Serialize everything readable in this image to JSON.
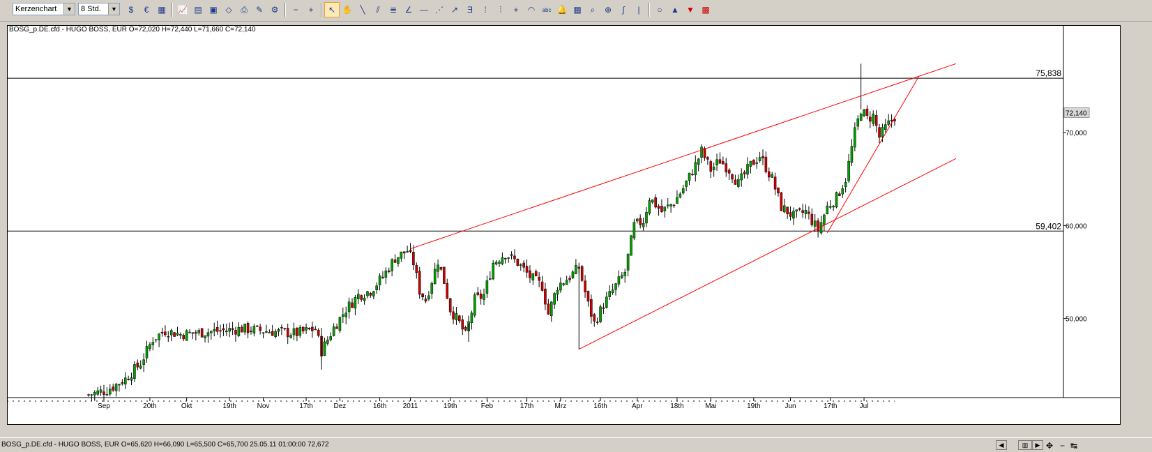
{
  "toolbar": {
    "chart_type": "Kerzenchart",
    "timeframe": "8 Std.",
    "tools": [
      "currency-dollar-icon",
      "currency-euro-icon",
      "indicator-grid-icon",
      "line-chart-icon",
      "table-icon",
      "image-icon",
      "eraser-icon",
      "print-icon",
      "paint-icon",
      "chart-settings-icon",
      "zoom-out-icon",
      "zoom-in-icon",
      "cursor-icon",
      "hand-icon",
      "line-tool-icon",
      "parallel-line-icon",
      "fibonacci-icon",
      "angle-icon",
      "horizontal-line-icon",
      "fan-icon",
      "trend-arrow-icon",
      "gann-icon",
      "vertical-line-icon",
      "cycle-lines-icon",
      "crosshair-icon",
      "arc-icon",
      "text-tool-icon",
      "alarm-icon",
      "calculator-icon",
      "magnifier-icon",
      "magnifier-plus-icon",
      "curve-icon",
      "vertical-bar-icon",
      "circle-icon",
      "arrow-up-icon",
      "arrow-down-icon",
      "color-palette-icon"
    ]
  },
  "chart_data": {
    "type": "candlestick",
    "title": "BOSG_p.DE.cfd - HUGO BOSS, EUR O=72,020 H=72,440 L=71,660 C=72,140",
    "instrument": "BOSG_p.DE.cfd - HUGO BOSS",
    "last_ohlc": {
      "open": 72.02,
      "high": 72.44,
      "low": 71.66,
      "close": 72.14
    },
    "ylim": [
      41.5,
      80.5
    ],
    "yticks": [
      {
        "value": 50,
        "label": "50,000"
      },
      {
        "value": 60,
        "label": "60,000"
      },
      {
        "value": 70,
        "label": "70,000"
      }
    ],
    "current_price_label": "72,140",
    "current_price": 72.14,
    "horizontal_lines": [
      {
        "value": 75.838,
        "label": "75,838"
      },
      {
        "value": 59.402,
        "label": "59,402"
      }
    ],
    "x_ticks": [
      "Sep",
      "20th",
      "Okt",
      "19th",
      "Nov",
      "17th",
      "Dez",
      "16th",
      "2011",
      "19th",
      "Feb",
      "17th",
      "Mrz",
      "16th",
      "Apr",
      "18th",
      "Mai",
      "19th",
      "Jun",
      "17th",
      "Jul"
    ],
    "x_tick_index": [
      5,
      20,
      32,
      46,
      57,
      71,
      82,
      95,
      105,
      118,
      130,
      143,
      154,
      167,
      179,
      192,
      203,
      217,
      229,
      242,
      253
    ],
    "bar_count": 264,
    "close_path": [
      [
        0,
        41.8
      ],
      [
        6,
        42.3
      ],
      [
        12,
        43.5
      ],
      [
        17,
        45.2
      ],
      [
        21,
        47.8
      ],
      [
        25,
        48.7
      ],
      [
        30,
        48.3
      ],
      [
        40,
        48.6
      ],
      [
        50,
        48.9
      ],
      [
        60,
        48.6
      ],
      [
        68,
        48.4
      ],
      [
        74,
        48.9
      ],
      [
        76,
        46.5
      ],
      [
        80,
        49.0
      ],
      [
        84,
        51.0
      ],
      [
        88,
        52.5
      ],
      [
        92,
        53.0
      ],
      [
        96,
        54.5
      ],
      [
        100,
        56.5
      ],
      [
        104,
        57.3
      ],
      [
        106,
        56.0
      ],
      [
        108,
        53.0
      ],
      [
        110,
        52.0
      ],
      [
        114,
        56.2
      ],
      [
        116,
        54.0
      ],
      [
        118,
        51.0
      ],
      [
        121,
        49.5
      ],
      [
        123,
        48.2
      ],
      [
        126,
        52.0
      ],
      [
        129,
        52.5
      ],
      [
        132,
        56.0
      ],
      [
        136,
        57.0
      ],
      [
        140,
        56.0
      ],
      [
        144,
        54.5
      ],
      [
        148,
        53.5
      ],
      [
        150,
        50.5
      ],
      [
        153,
        53.5
      ],
      [
        157,
        54.5
      ],
      [
        160,
        55.5
      ],
      [
        163,
        51.5
      ],
      [
        165,
        49.5
      ],
      [
        168,
        51.5
      ],
      [
        172,
        53.5
      ],
      [
        175,
        55.0
      ],
      [
        178,
        60.0
      ],
      [
        181,
        60.5
      ],
      [
        183,
        63.0
      ],
      [
        187,
        61.5
      ],
      [
        191,
        62.5
      ],
      [
        194,
        64.0
      ],
      [
        198,
        66.5
      ],
      [
        200,
        68.0
      ],
      [
        203,
        66.0
      ],
      [
        206,
        67.0
      ],
      [
        209,
        66.0
      ],
      [
        212,
        64.5
      ],
      [
        216,
        66.5
      ],
      [
        219,
        67.5
      ],
      [
        223,
        65.0
      ],
      [
        226,
        62.0
      ],
      [
        230,
        61.0
      ],
      [
        234,
        61.5
      ],
      [
        238,
        59.5
      ],
      [
        241,
        62.0
      ],
      [
        244,
        63.0
      ],
      [
        247,
        65.0
      ],
      [
        250,
        70.0
      ],
      [
        252,
        72.5
      ],
      [
        254,
        71.5
      ],
      [
        256,
        71.8
      ],
      [
        258,
        69.5
      ],
      [
        260,
        70.5
      ],
      [
        264,
        72.14
      ]
    ],
    "trend_lines": [
      {
        "x1": 105,
        "y1": 57.5,
        "x2": 283,
        "y2": 77.4
      },
      {
        "x1": 160,
        "y1": 46.7,
        "x2": 283,
        "y2": 67.2
      },
      {
        "x1": 241,
        "y1": 59.2,
        "x2": 271,
        "y2": 76.1
      }
    ],
    "colors": {
      "up": "#00a000",
      "down": "#cc0000",
      "trend": "#ff0000",
      "hline": "#000000"
    }
  },
  "statusbar": {
    "text": "BOSG_p.DE.cfd - HUGO BOSS, EUR O=65,620 H=66,090 L=65,500 C=65,700   25.05.11 01:00:00 72,672",
    "buttons": [
      "nav-left-button",
      "nav-page-button",
      "nav-right-button",
      "crosshair-button",
      "minus-button",
      "fit-button"
    ]
  }
}
